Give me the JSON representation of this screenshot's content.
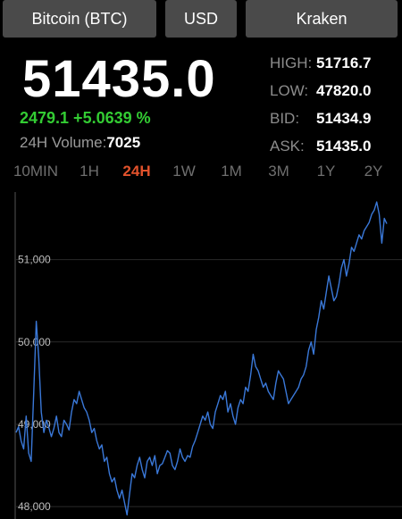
{
  "selectors": {
    "coin": "Bitcoin (BTC)",
    "currency": "USD",
    "exchange": "Kraken"
  },
  "ticker": {
    "price": "51435.0",
    "change": "2479.1 +5.0639 %",
    "volume_label": "24H Volume:",
    "volume": "7025"
  },
  "stats": [
    {
      "label": "HIGH:",
      "value": "51716.7"
    },
    {
      "label": "LOW:",
      "value": "47820.0"
    },
    {
      "label": "BID:",
      "value": "51434.9"
    },
    {
      "label": "ASK:",
      "value": "51435.0"
    }
  ],
  "ranges": [
    "10MIN",
    "1H",
    "24H",
    "1W",
    "1M",
    "3M",
    "1Y",
    "2Y"
  ],
  "active_range": "24H",
  "colors": {
    "up": "#33cc33",
    "active_range": "#e2522c",
    "line": "#3a78d8",
    "button": "#4a4a4a"
  },
  "chart_data": {
    "type": "line",
    "y_ticks": [
      {
        "value": 48000,
        "label": "48,000"
      },
      {
        "value": 49000,
        "label": "49,000"
      },
      {
        "value": 50000,
        "label": "50,000"
      },
      {
        "value": 51000,
        "label": "51,000"
      }
    ],
    "ylim": [
      47850,
      51820
    ],
    "grid": true,
    "series": [
      {
        "values": [
          48900,
          48970,
          48800,
          48700,
          49100,
          48650,
          48550,
          49400,
          50250,
          49800,
          49150,
          48900,
          49050,
          48960,
          48850,
          48950,
          49100,
          48900,
          48850,
          49050,
          49000,
          48930,
          49150,
          49300,
          49250,
          49400,
          49300,
          49200,
          49150,
          49050,
          48900,
          48950,
          48800,
          48700,
          48750,
          48550,
          48600,
          48400,
          48300,
          48350,
          48200,
          48100,
          48200,
          48050,
          47900,
          48150,
          48400,
          48350,
          48500,
          48600,
          48450,
          48350,
          48550,
          48600,
          48500,
          48620,
          48400,
          48500,
          48520,
          48600,
          48680,
          48650,
          48500,
          48450,
          48550,
          48700,
          48600,
          48550,
          48620,
          48600,
          48730,
          48800,
          48900,
          49000,
          49100,
          49050,
          49150,
          49000,
          48950,
          49150,
          49250,
          49350,
          49300,
          49400,
          49150,
          49250,
          49100,
          49000,
          49200,
          49300,
          49250,
          49450,
          49400,
          49600,
          49850,
          49700,
          49650,
          49550,
          49450,
          49500,
          49400,
          49350,
          49300,
          49500,
          49650,
          49600,
          49550,
          49400,
          49250,
          49300,
          49350,
          49400,
          49450,
          49550,
          49600,
          49700,
          49900,
          50000,
          49850,
          50150,
          50300,
          50500,
          50400,
          50600,
          50800,
          50650,
          50500,
          50550,
          50700,
          50900,
          51000,
          50800,
          50950,
          51150,
          51100,
          51200,
          51300,
          51250,
          51350,
          51400,
          51450,
          51550,
          51600,
          51700,
          51550,
          51200,
          51500,
          51435
        ]
      }
    ]
  }
}
